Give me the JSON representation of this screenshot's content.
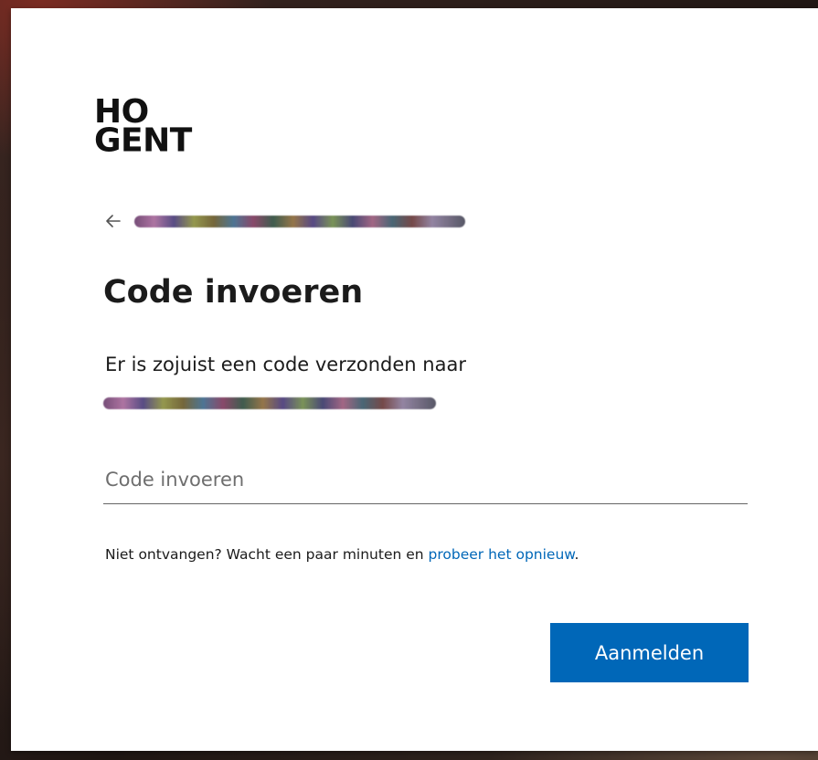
{
  "brand": {
    "logo_line1": "HO",
    "logo_line2": "GENT"
  },
  "header": {
    "back_icon": "arrow-left-icon"
  },
  "main": {
    "title": "Code invoeren",
    "description": "Er is zojuist een code verzonden naar",
    "code_placeholder": "Code invoeren",
    "code_value": "",
    "resend_text": "Niet ontvangen? Wacht een paar minuten en ",
    "resend_link": "probeer het opnieuw",
    "resend_suffix": ".",
    "submit_label": "Aanmelden"
  },
  "colors": {
    "accent": "#0067b8",
    "text": "#1b1b1b",
    "card": "#ffffff"
  }
}
